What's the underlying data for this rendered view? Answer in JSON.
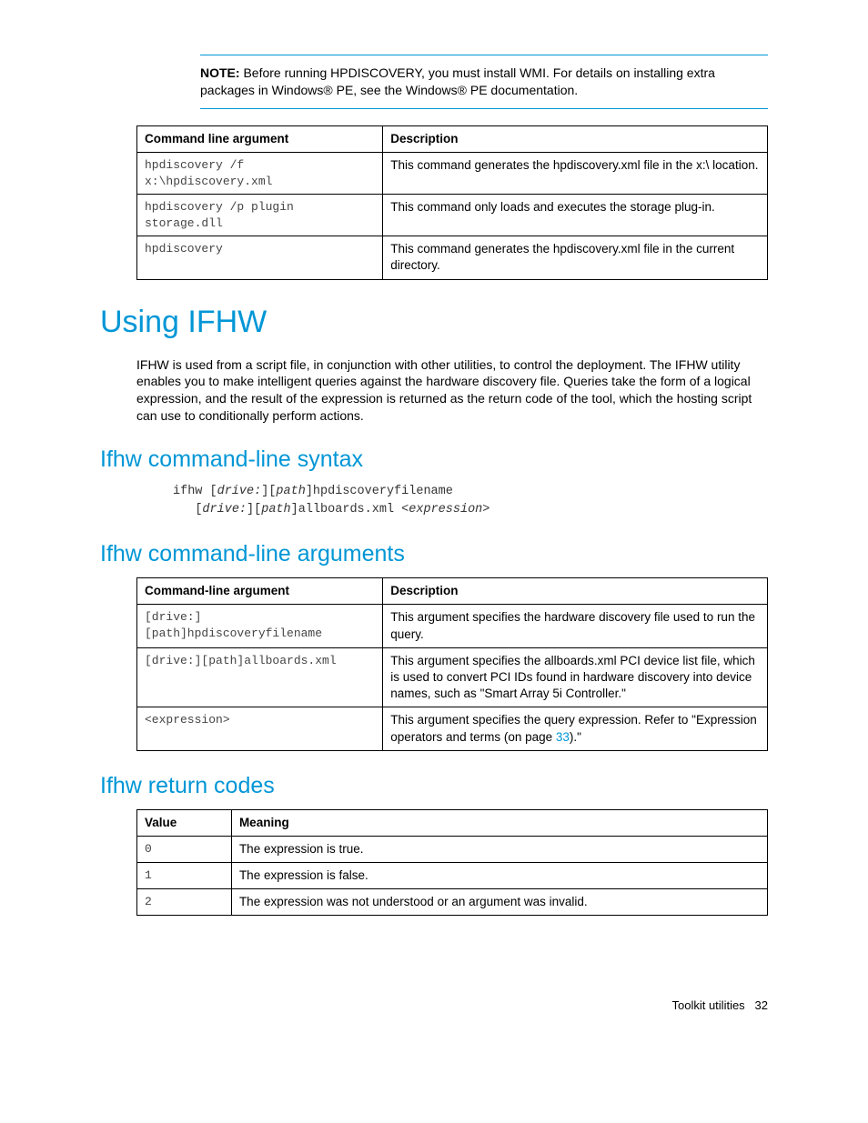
{
  "note": {
    "label": "NOTE:",
    "text": " Before running HPDISCOVERY, you must install WMI. For details on installing extra packages in Windows® PE, see the Windows® PE documentation."
  },
  "table1": {
    "headers": {
      "c1": "Command line argument",
      "c2": "Description"
    },
    "rows": [
      {
        "arg": "hpdiscovery /f x:\\hpdiscovery.xml",
        "desc": "This command generates the hpdiscovery.xml file in the x:\\ location."
      },
      {
        "arg": "hpdiscovery /p plugin storage.dll",
        "desc": "This command only loads and executes the storage plug-in."
      },
      {
        "arg": "hpdiscovery",
        "desc": "This command generates the hpdiscovery.xml file in the current directory."
      }
    ]
  },
  "h1": "Using IFHW",
  "intro": "IFHW is used from a script file, in conjunction with other utilities, to control the deployment. The IFHW utility enables you to make intelligent queries against the hardware discovery file. Queries take the form of a logical expression, and the result of the expression is returned as the return code of the tool, which the hosting script can use to conditionally perform actions.",
  "syntax": {
    "heading": "Ifhw command-line syntax",
    "l1a": "ifhw [",
    "l1b": "drive:",
    "l1c": "][",
    "l1d": "path",
    "l1e": "]hpdiscoveryfilename",
    "l2a": "[",
    "l2b": "drive:",
    "l2c": "][",
    "l2d": "path",
    "l2e": "]allboards.xml <",
    "l2f": "expression",
    "l2g": ">"
  },
  "args": {
    "heading": "Ifhw command-line arguments",
    "headers": {
      "c1": "Command-line argument",
      "c2": "Description"
    },
    "rows": [
      {
        "arg": "[drive:][path]hpdiscoveryfilename",
        "desc": "This argument specifies the hardware discovery file used to run the query."
      },
      {
        "arg": "[drive:][path]allboards.xml",
        "desc": "This argument specifies the allboards.xml PCI device list file, which is used to convert PCI IDs found in hardware discovery into device names, such as \"Smart Array 5i Controller.\""
      },
      {
        "arg": "<expression>",
        "desc_pre": "This argument specifies the query expression. Refer to \"Expression operators and terms (on page ",
        "link": "33",
        "desc_post": ").\""
      }
    ]
  },
  "returns": {
    "heading": "Ifhw return codes",
    "headers": {
      "c1": "Value",
      "c2": "Meaning"
    },
    "rows": [
      {
        "val": "0",
        "mean": "The expression is true."
      },
      {
        "val": "1",
        "mean": "The expression is false."
      },
      {
        "val": "2",
        "mean": "The expression was not understood or an argument was invalid."
      }
    ]
  },
  "footer": {
    "label": "Toolkit utilities",
    "page": "32"
  }
}
